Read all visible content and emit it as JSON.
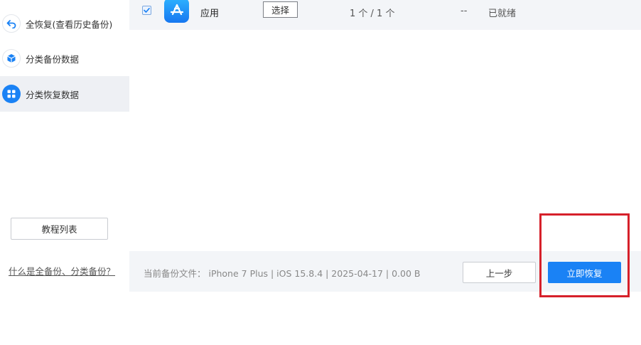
{
  "sidebar": {
    "items": [
      {
        "label": "全恢复(查看历史备份)",
        "icon": "back-arrow-icon",
        "active": false
      },
      {
        "label": "分类备份数据",
        "icon": "cube-icon",
        "active": false
      },
      {
        "label": "分类恢复数据",
        "icon": "grid-icon",
        "active": true
      }
    ],
    "tutorial_label": "教程列表",
    "help_link": "什么是全备份、分类备份？"
  },
  "table": {
    "rows": [
      {
        "checked": true,
        "icon": "app-store-icon",
        "name": "应用",
        "select_label": "选择",
        "count": "1 个 / 1 个",
        "size": "--",
        "status": "已就绪"
      }
    ]
  },
  "footer": {
    "info": "当前备份文件： iPhone 7 Plus | iOS 15.8.4 | 2025-04-17 | 0.00 B",
    "prev_label": "上一步",
    "restore_label": "立即恢复"
  },
  "colors": {
    "accent": "#1a82f5",
    "highlight": "#d6202a",
    "panel_bg": "#f3f5f8"
  }
}
